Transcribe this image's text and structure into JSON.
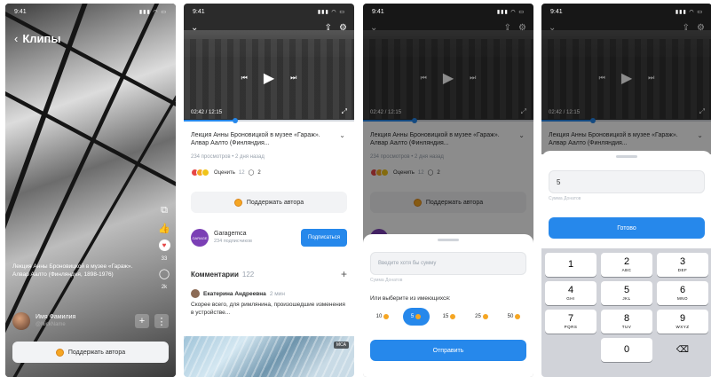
{
  "status_time": "9:41",
  "screen1": {
    "back_title": "Клипы",
    "caption": "Лекция Анны Броновицкой в музее «Гараж». Алвар Аалто (Финляндия, 1898-1976)",
    "likes": "33",
    "comments_count": "2k",
    "author_name": "Имя Фамилия",
    "author_nick": "@NickName",
    "support_label": "Поддержать автора"
  },
  "video": {
    "title": "Лекция Анны Броновицкой в музее «Гараж». Алвар Аалто (Финляндия...",
    "meta": "234 просмотров • 2 дня назад",
    "time": "02:42 / 12:15",
    "rate_label": "Оценить",
    "rate_count": "12",
    "comment_count": "2",
    "support_label": "Поддержать автора",
    "progress_pct": 0.3
  },
  "channel": {
    "name": "Garagemca",
    "subs": "234 подписчиков",
    "subscribe_label": "Подписаться",
    "logo_text": "GARAGE"
  },
  "comments": {
    "title": "Комментарии",
    "count": "122",
    "author": "Екатерина Андреевна",
    "ago": "2 мин",
    "text": "Скорее всего, для римлянина, произошедшие изменения в устройстве..."
  },
  "next_badge": "MCA",
  "donate": {
    "placeholder": "Введите хотя бы сумму",
    "note": "Сумма Донатов",
    "choose_label": "Или выберите из имеющихся:",
    "chips": [
      "10",
      "5",
      "15",
      "25",
      "50"
    ],
    "selected_index": 1,
    "send_label": "Отправить"
  },
  "keypad_screen": {
    "value": "5",
    "note": "Сумма Донатов",
    "ready_label": "Готово",
    "keys": [
      {
        "n": "1",
        "l": ""
      },
      {
        "n": "2",
        "l": "ABC"
      },
      {
        "n": "3",
        "l": "DEF"
      },
      {
        "n": "4",
        "l": "GHI"
      },
      {
        "n": "5",
        "l": "JKL"
      },
      {
        "n": "6",
        "l": "MNO"
      },
      {
        "n": "7",
        "l": "PQRS"
      },
      {
        "n": "8",
        "l": "TUV"
      },
      {
        "n": "9",
        "l": "WXYZ"
      }
    ],
    "zero": "0"
  },
  "colors": {
    "accent": "#2688eb",
    "coin": "#f5a623"
  }
}
